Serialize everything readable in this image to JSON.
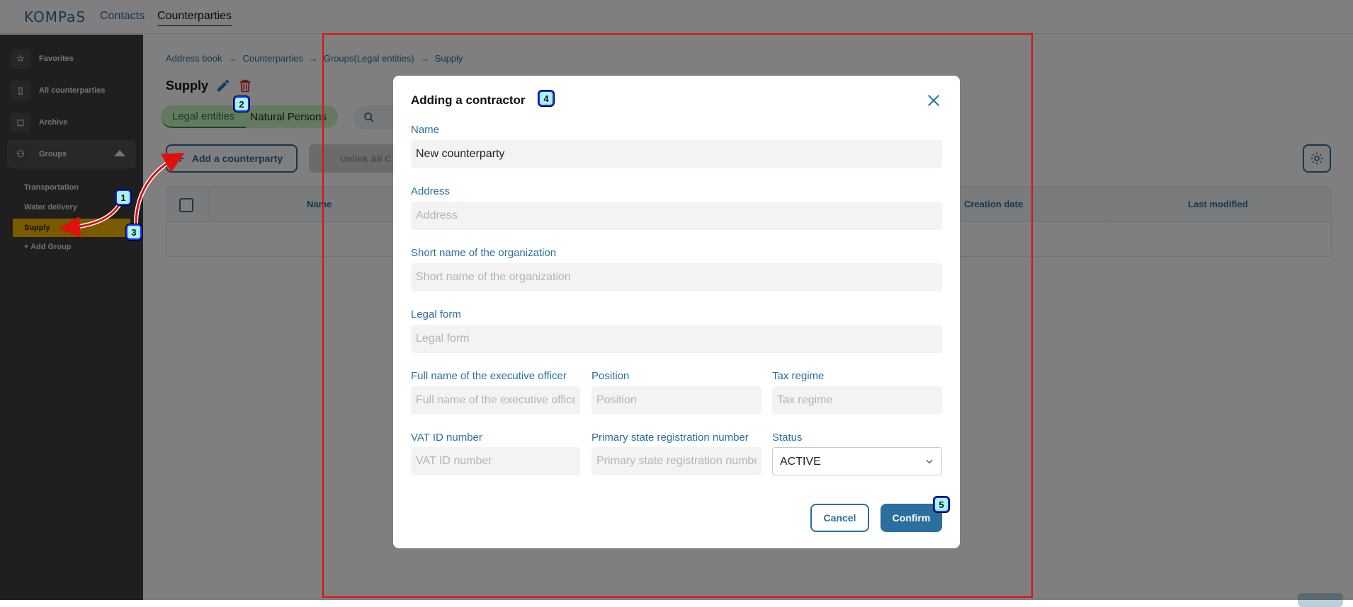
{
  "topbar": {
    "logo": "KOMPaS",
    "nav_contacts": "Contacts",
    "nav_counterparties": "Counterparties"
  },
  "sidebar": {
    "items": [
      {
        "label": "Favorites",
        "icon": "star-icon"
      },
      {
        "label": "All counterparties",
        "icon": "contacts-icon"
      },
      {
        "label": "Archive",
        "icon": "archive-icon"
      },
      {
        "label": "Groups",
        "icon": "users-icon"
      }
    ],
    "groups": [
      "Transportation",
      "Water delivery",
      "Supply",
      "+ Add Group"
    ]
  },
  "breadcrumb": [
    "Address book",
    "Counterparties",
    "Groups(Legal entities)",
    "Supply"
  ],
  "page": {
    "title": "Supply",
    "tab_legal": "Legal entities",
    "tab_natural": "Natural Persons",
    "add_button": "Add a counterparty",
    "unlink_button": "Unlink All C"
  },
  "table": {
    "columns": [
      "Name",
      "Creation date",
      "Last modified"
    ]
  },
  "modal": {
    "title": "Adding a contractor",
    "name_label": "Name",
    "name_value": "New counterparty",
    "address_label": "Address",
    "address_placeholder": "Address",
    "short_name_label": "Short name of the organization",
    "short_name_placeholder": "Short name of the organization",
    "legal_form_label": "Legal form",
    "legal_form_placeholder": "Legal form",
    "exec_label": "Full name of the executive officer",
    "exec_placeholder": "Full name of the executive officer",
    "position_label": "Position",
    "position_placeholder": "Position",
    "tax_label": "Tax regime",
    "tax_placeholder": "Tax regime",
    "vat_label": "VAT ID number",
    "vat_placeholder": "VAT ID number",
    "psrn_label": "Primary state registration number",
    "psrn_placeholder": "Primary state registration number",
    "status_label": "Status",
    "status_value": "ACTIVE",
    "cancel": "Cancel",
    "confirm": "Confirm"
  },
  "annotations": [
    "1",
    "2",
    "3",
    "4",
    "5"
  ],
  "colors": {
    "accent": "#2a6f9e",
    "sidebar_bg": "#3e3e3e",
    "selected_group": "#f5b400",
    "tab_bg": "#c9f5c0",
    "highlight_border": "#e01010"
  }
}
